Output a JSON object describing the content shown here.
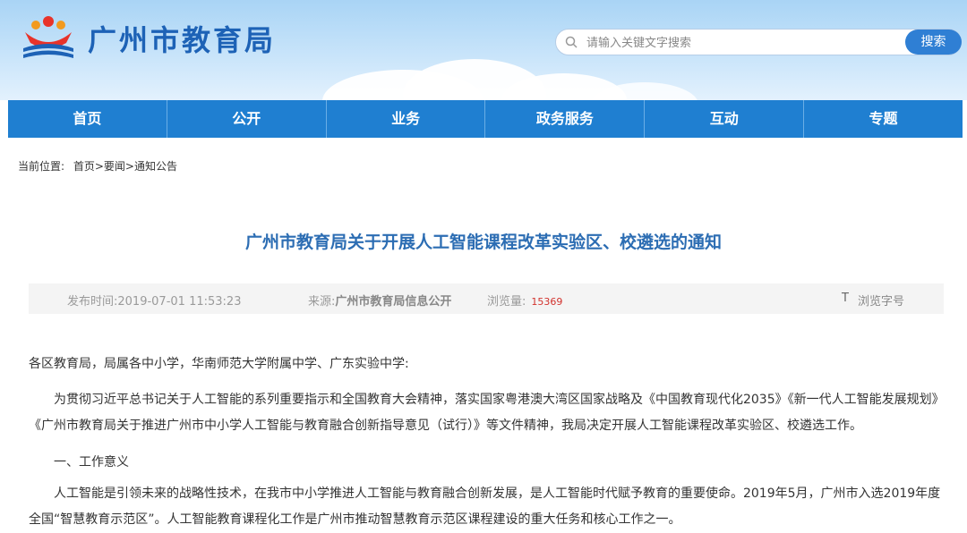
{
  "header": {
    "site_title": "广州市教育局",
    "search_placeholder": "请输入关键文字搜索",
    "search_button": "搜索"
  },
  "nav": {
    "items": [
      "首页",
      "公开",
      "业务",
      "政务服务",
      "互动",
      "专题"
    ]
  },
  "breadcrumb": {
    "label": "当前位置:",
    "path": "首页>要闻>通知公告"
  },
  "article": {
    "title": "广州市教育局关于开展人工智能课程改革实验区、校遴选的通知",
    "meta": {
      "publish_label": "发布时间:",
      "publish_time": "2019-07-01 11:53:23",
      "source_label": "来源:",
      "source": "广州市教育局信息公开",
      "views_label": "浏览量:",
      "views": "15369",
      "font_icon": "T",
      "font_label": "浏览字号"
    },
    "salutation": "各区教育局，局属各中小学，华南师范大学附属中学、广东实验中学:",
    "para1": "为贯彻习近平总书记关于人工智能的系列重要指示和全国教育大会精神，落实国家粤港澳大湾区国家战略及《中国教育现代化2035》《新一代人工智能发展规划》《广州市教育局关于推进广州市中小学人工智能与教育融合创新指导意见（试行）》等文件精神，我局决定开展人工智能课程改革实验区、校遴选工作。",
    "section1": "一、工作意义",
    "para2": "人工智能是引领未来的战略性技术，在我市中小学推进人工智能与教育融合创新发展，是人工智能时代赋予教育的重要使命。2019年5月，广州市入选2019年度全国“智慧教育示范区”。人工智能教育课程化工作是广州市推动智慧教育示范区课程建设的重大任务和核心工作之一。"
  },
  "colors": {
    "brand_blue": "#1f7fd1",
    "title_blue": "#2c6db3",
    "views_red": "#d2322d"
  }
}
